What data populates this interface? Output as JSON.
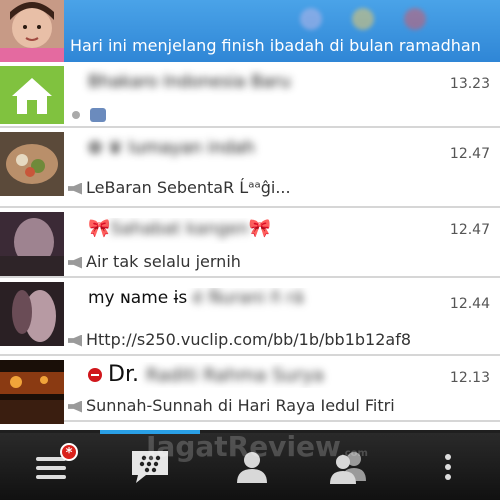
{
  "banner": {
    "status": "Hari ini menjelang finish ibadah di bulan ramadhan"
  },
  "chats": [
    {
      "name": "Bhakaro Indonesia Baru",
      "time": "13.23",
      "preview": "",
      "avatar": "home-icon"
    },
    {
      "name": "✿ ♛ lumayan indah",
      "time": "12.47",
      "preview": "LeBaran SebentaR Ĺᵃᵃĝi..."
    },
    {
      "name": "Sahabat kangen",
      "time": "12.47",
      "preview": "Air tak selalu jernih"
    },
    {
      "name": "my ɴame ɨs",
      "name_blurred": "é Ňurani ñ rá",
      "time": "12.44",
      "preview": "Http://s250.vuclip.com/bb/1b/bb1b12af8"
    },
    {
      "name": "Dr.",
      "name_blurred": "Raditi Rahma Surya",
      "time": "12.13",
      "preview": "Sunnah-Sunnah di Hari Raya Iedul Fitri"
    }
  ],
  "tabbar": {
    "badge": "*",
    "tabs": [
      "menu",
      "bbm-chats",
      "contacts",
      "groups",
      "more"
    ]
  },
  "watermark": {
    "text": "JagatReview",
    "suffix": ".com"
  }
}
